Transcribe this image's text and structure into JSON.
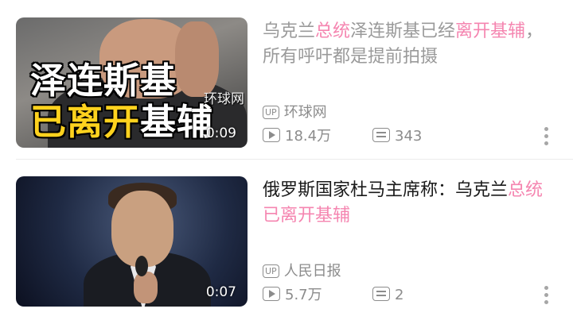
{
  "videos": [
    {
      "title_segments": [
        {
          "text": "乌克兰",
          "style": "dim"
        },
        {
          "text": "总统",
          "style": "pink"
        },
        {
          "text": "泽连斯基已经",
          "style": "dim"
        },
        {
          "text": "离开基辅",
          "style": "pink"
        },
        {
          "text": "，所有呼吁都是提前拍摄",
          "style": "dim"
        }
      ],
      "thumb_caption_line1": "泽连斯基",
      "thumb_caption_line2_yellow": "已离开",
      "thumb_caption_line2_white": "基辅",
      "thumb_watermark": "环球网",
      "duration": "0:09",
      "up_badge": "UP",
      "uploader": "环球网",
      "plays": "18.4万",
      "comments": "343",
      "more_icon": "more-vertical-icon"
    },
    {
      "title_segments": [
        {
          "text": "俄罗斯国家杜马主席称：乌克兰",
          "style": "black"
        },
        {
          "text": "总统已离开基辅",
          "style": "pink"
        }
      ],
      "duration": "0:07",
      "up_badge": "UP",
      "uploader": "人民日报",
      "plays": "5.7万",
      "comments": "2",
      "more_icon": "more-vertical-icon"
    }
  ],
  "colors": {
    "highlight": "#f585b0",
    "caption_yellow": "#ffd21e",
    "meta_gray": "#8c8c8c"
  }
}
